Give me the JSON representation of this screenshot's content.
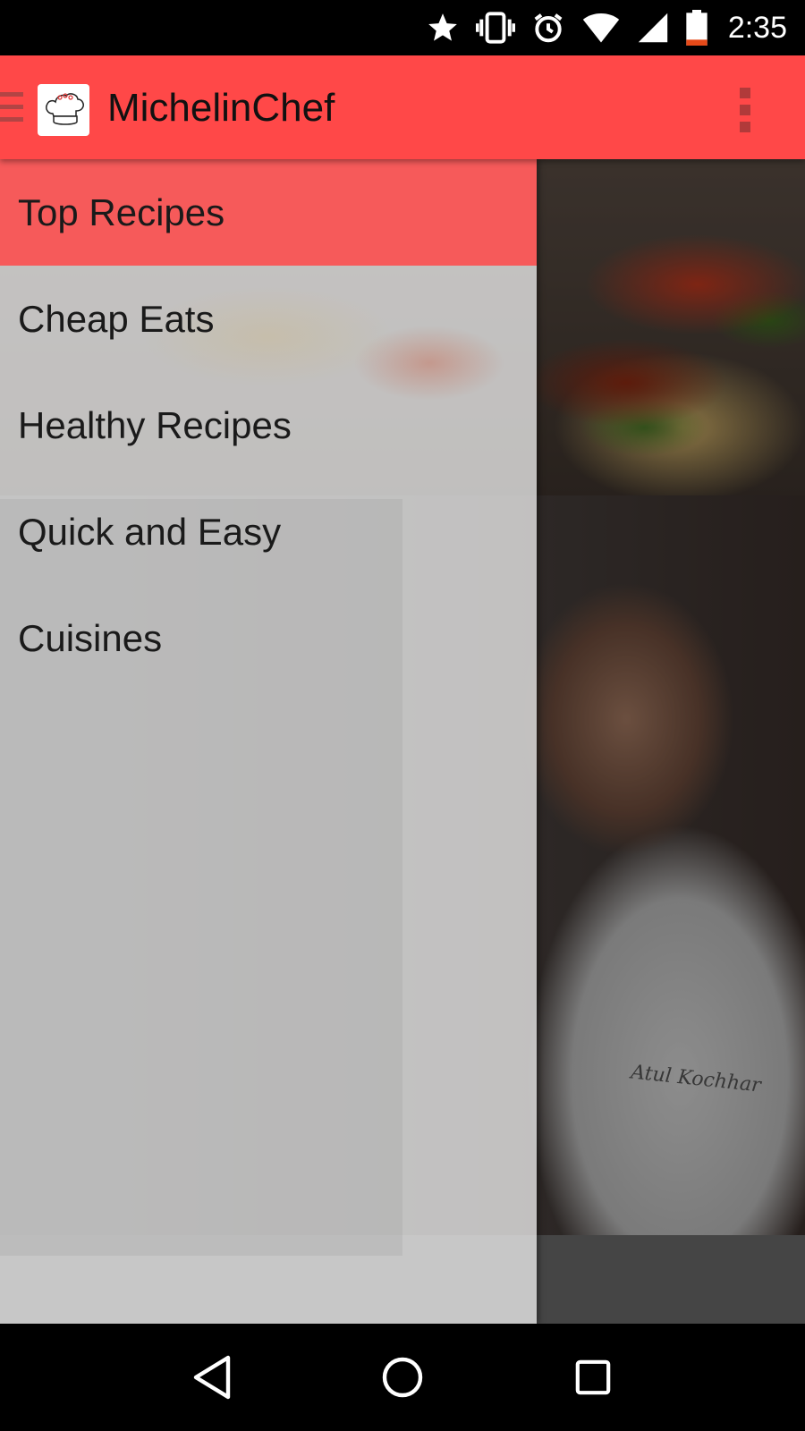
{
  "status_bar": {
    "time": "2:35",
    "icons": [
      "star-icon",
      "vibrate-icon",
      "alarm-icon",
      "wifi-icon",
      "signal-icon",
      "battery-icon"
    ]
  },
  "app_bar": {
    "title": "MichelinChef",
    "color": "#ff4848",
    "icons": [
      "hamburger-icon",
      "chef-hat-logo",
      "overflow-menu-icon"
    ]
  },
  "drawer": {
    "items": [
      {
        "label": "Top Recipes",
        "active": true
      },
      {
        "label": "Cheap Eats",
        "active": false
      },
      {
        "label": "Healthy Recipes",
        "active": false
      },
      {
        "label": "Quick and Easy",
        "active": false
      },
      {
        "label": "Cuisines",
        "active": false
      }
    ]
  },
  "content": {
    "cards": [
      {
        "type": "image",
        "subject": "tacos"
      },
      {
        "type": "image",
        "subject": "chef portrait",
        "signature": "Atul Kochhar"
      }
    ]
  },
  "nav_bar": {
    "icons": [
      "back-icon",
      "home-icon",
      "recents-icon"
    ]
  }
}
